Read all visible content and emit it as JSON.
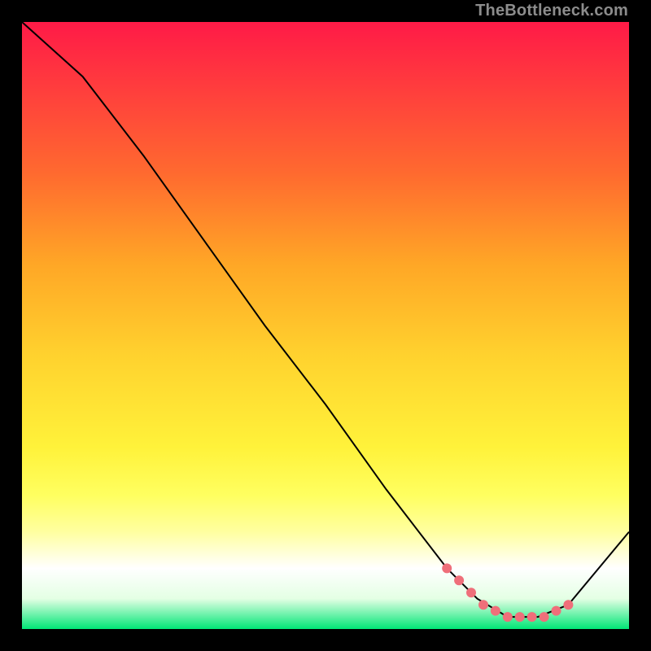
{
  "watermark": "TheBottleneck.com",
  "chart_data": {
    "type": "line",
    "title": "",
    "xlabel": "",
    "ylabel": "",
    "xlim": [
      0,
      100
    ],
    "ylim": [
      0,
      100
    ],
    "grid": false,
    "series": [
      {
        "name": "curve",
        "x": [
          0,
          10,
          20,
          30,
          40,
          50,
          60,
          70,
          75,
          80,
          85,
          90,
          100
        ],
        "y": [
          100,
          91,
          78,
          64,
          50,
          37,
          23,
          10,
          5,
          2,
          2,
          4,
          16
        ],
        "stroke": "#000000",
        "stroke_width": 2
      }
    ],
    "markers": {
      "name": "highlight-dots",
      "x": [
        70,
        72,
        74,
        76,
        78,
        80,
        82,
        84,
        86,
        88,
        90
      ],
      "y": [
        10,
        8,
        6,
        4,
        3,
        2,
        2,
        2,
        2,
        3,
        4
      ],
      "color": "#ef6f7a",
      "radius": 6
    },
    "background_gradient": {
      "top": "#ff1a47",
      "mid": "#ffd22e",
      "bottom": "#00e676"
    }
  }
}
